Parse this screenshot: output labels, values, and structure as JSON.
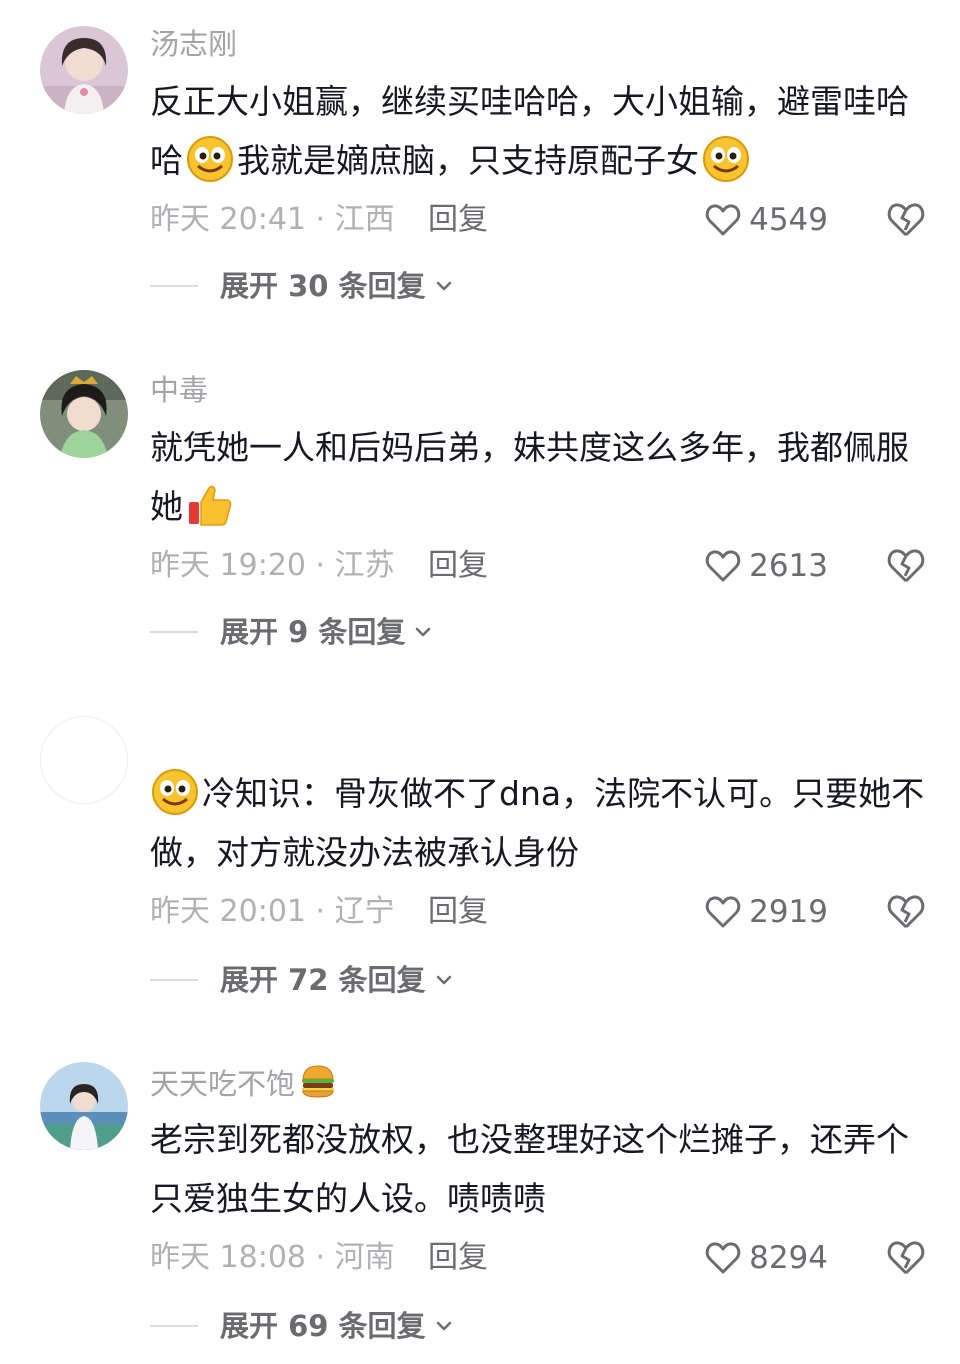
{
  "comments": [
    {
      "username": "汤志刚",
      "text_parts": [
        "反正大小姐赢，继续买哇哈哈，大小姐输，避雷哇哈哈",
        "我就是嫡庶脑，只支持原配子女",
        ""
      ],
      "emojis": [
        "grin-emoji",
        "grin-emoji"
      ],
      "time_location": "昨天 20:41 · 江西",
      "reply_label": "回复",
      "likes": "4549",
      "expand_label": "展开 30 条回复"
    },
    {
      "username": "中毒",
      "text_parts": [
        "就凭她一人和后妈后弟，妹共度这么多年，我都佩服她",
        ""
      ],
      "emojis": [
        "thumbs-up-emoji"
      ],
      "time_location": "昨天 19:20 · 江苏",
      "reply_label": "回复",
      "likes": "2613",
      "expand_label": "展开 9 条回复"
    },
    {
      "username": "",
      "text_parts": [
        "",
        "冷知识：骨灰做不了dna，法院不认可。只要她不做，对方就没办法被承认身份"
      ],
      "emojis": [
        "grin-emoji"
      ],
      "time_location": "昨天 20:01 · 辽宁",
      "reply_label": "回复",
      "likes": "2919",
      "expand_label": "展开 72 条回复"
    },
    {
      "username": "天天吃不饱",
      "username_emoji": "burger-emoji",
      "text_parts": [
        "老宗到死都没放权，也没整理好这个烂摊子，还弄个只爱独生女的人设。啧啧啧"
      ],
      "emojis": [],
      "time_location": "昨天 18:08 · 河南",
      "reply_label": "回复",
      "likes": "8294",
      "expand_label": "展开 69 条回复"
    }
  ],
  "colors": {
    "username": "#a3a3a8",
    "text": "#161823",
    "meta": "#b1b1b5",
    "action": "#6b6c72"
  },
  "icons": [
    "heart-icon",
    "broken-heart-icon",
    "chevron-down-icon"
  ]
}
